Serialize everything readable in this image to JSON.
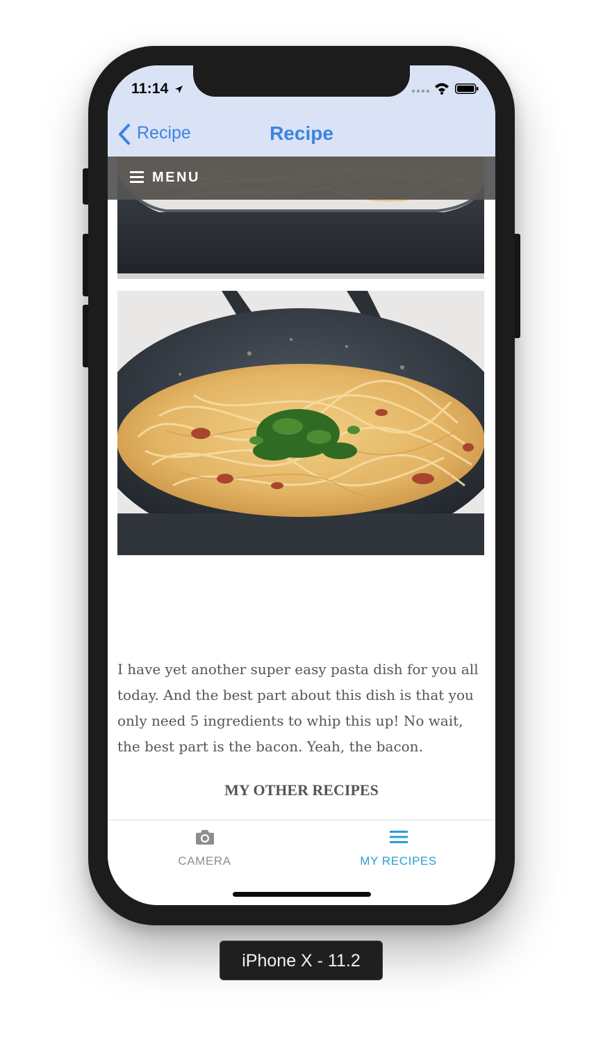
{
  "status_bar": {
    "time": "11:14",
    "icons": [
      "location-arrow-icon",
      "signal-icon",
      "wifi-icon",
      "battery-icon"
    ]
  },
  "nav": {
    "back_label": "Recipe",
    "title": "Recipe",
    "accent_color": "#3a84e0",
    "background_color": "#dae2f6"
  },
  "menu": {
    "label": "MENU",
    "icon": "hamburger-icon"
  },
  "content": {
    "images": [
      "pasta-pan-photo",
      "pasta-carbonara-photo"
    ],
    "paragraph": "I have yet another super easy pasta dish for you all today. And the best part about this dish is that you only need 5 ingredients to whip this up! No wait, the best part is the bacon. Yeah, the bacon.",
    "section_heading": "MY OTHER RECIPES"
  },
  "tabbar": {
    "tabs": [
      {
        "label": "CAMERA",
        "icon": "camera-icon",
        "selected": false
      },
      {
        "label": "MY RECIPES",
        "icon": "list-icon",
        "selected": true
      }
    ],
    "active_color": "#2a9ed6",
    "inactive_color": "#8e8e8e"
  },
  "device": {
    "label": "iPhone X - 11.2"
  }
}
